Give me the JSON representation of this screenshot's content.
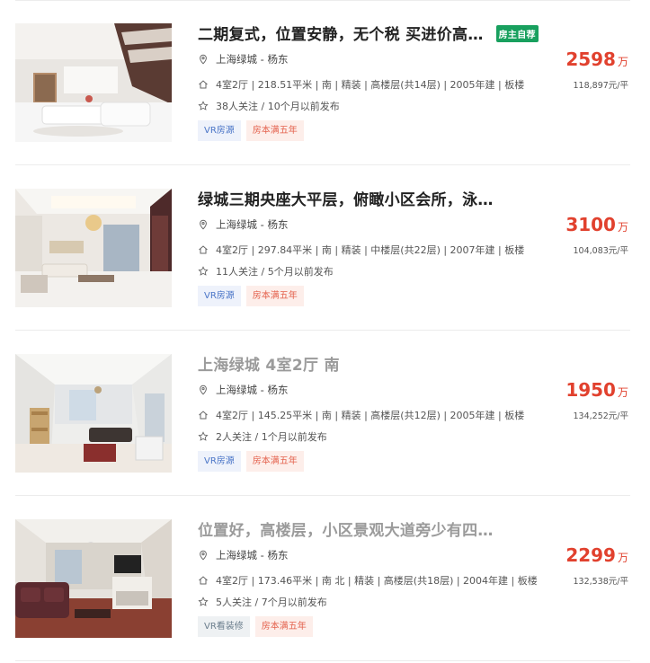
{
  "listings": [
    {
      "title": "二期复式，位置安静，无个税 买进价高…",
      "badge": "房主自荐",
      "location": "上海绿城 - 杨东",
      "info": "4室2厅 | 218.51平米 | 南 | 精装 | 高楼层(共14层) | 2005年建 | 板楼",
      "follow": "38人关注 / 10个月以前发布",
      "tags": [
        "VR房源",
        "房本满五年"
      ],
      "price": "2598",
      "price_unit": "万",
      "unit_price": "118,897元/平"
    },
    {
      "title": "绿城三期央座大平层，俯瞰小区会所，泳…",
      "badge": "",
      "location": "上海绿城 - 杨东",
      "info": "4室2厅 | 297.84平米 | 南 | 精装 | 中楼层(共22层) | 2007年建 | 板楼",
      "follow": "11人关注 / 5个月以前发布",
      "tags": [
        "VR房源",
        "房本满五年"
      ],
      "price": "3100",
      "price_unit": "万",
      "unit_price": "104,083元/平"
    },
    {
      "title": "上海绿城 4室2厅 南",
      "badge": "",
      "location": "上海绿城 - 杨东",
      "info": "4室2厅 | 145.25平米 | 南 | 精装 | 高楼层(共12层) | 2005年建 | 板楼",
      "follow": "2人关注 / 1个月以前发布",
      "tags": [
        "VR房源",
        "房本满五年"
      ],
      "price": "1950",
      "price_unit": "万",
      "unit_price": "134,252元/平"
    },
    {
      "title": "位置好，高楼层，小区景观大道旁少有四…",
      "badge": "",
      "location": "上海绿城 - 杨东",
      "info": "4室2厅 | 173.46平米 | 南 北 | 精装 | 高楼层(共18层) | 2004年建 | 板楼",
      "follow": "5人关注 / 7个月以前发布",
      "tags": [
        "VR看装修",
        "房本满五年"
      ],
      "price": "2299",
      "price_unit": "万",
      "unit_price": "132,538元/平"
    }
  ],
  "colors": {
    "price": "#e1412e",
    "badge_bg": "#18a05e",
    "visited_title": "#9b9b9b",
    "vr_tag": "#4a75c7",
    "five_year_tag": "#e4624d"
  },
  "icons": [
    "location-pin-icon",
    "house-icon",
    "star-icon"
  ]
}
